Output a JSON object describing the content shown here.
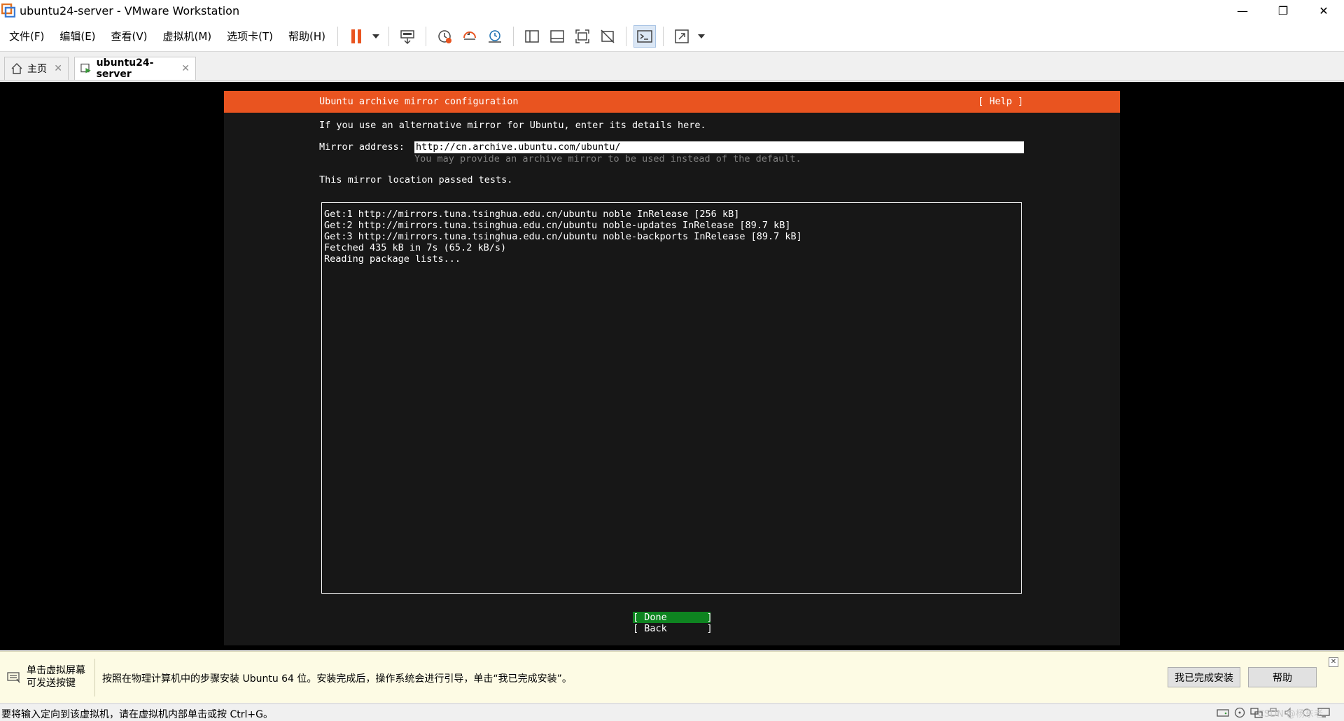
{
  "window": {
    "title": "ubuntu24-server - VMware Workstation",
    "controls": {
      "minimize": "—",
      "restore": "❐",
      "close": "✕"
    }
  },
  "menu": {
    "items": [
      "文件(F)",
      "编辑(E)",
      "查看(V)",
      "虚拟机(M)",
      "选项卡(T)",
      "帮助(H)"
    ]
  },
  "toolbar": {
    "icons": [
      "pause-icon",
      "dropdown-icon",
      "send-ctrl-alt-del-icon",
      "snapshot-icon",
      "revert-snapshot-icon",
      "snapshot-manager-icon",
      "library-icon",
      "thumbnail-icon",
      "fullscreen-icon",
      "unity-icon",
      "console-view-icon",
      "stretch-icon"
    ],
    "accent": "#e95420"
  },
  "tabs": [
    {
      "label": "主页",
      "icon": "home-icon",
      "active": false
    },
    {
      "label": "ubuntu24-server",
      "icon": "vm-icon",
      "active": true
    }
  ],
  "console": {
    "header_title": "Ubuntu archive mirror configuration",
    "help_label": "[ Help ]",
    "intro": "If you use an alternative mirror for Ubuntu, enter its details here.",
    "mirror_label": "Mirror address:",
    "mirror_value": "http://cn.archive.ubuntu.com/ubuntu/",
    "mirror_hint": "You may provide an archive mirror to be used instead of the default.",
    "status": "This mirror location passed tests.",
    "log_lines": [
      "Get:1 http://mirrors.tuna.tsinghua.edu.cn/ubuntu noble InRelease [256 kB]",
      "Get:2 http://mirrors.tuna.tsinghua.edu.cn/ubuntu noble-updates InRelease [89.7 kB]",
      "Get:3 http://mirrors.tuna.tsinghua.edu.cn/ubuntu noble-backports InRelease [89.7 kB]",
      "Fetched 435 kB in 7s (65.2 kB/s)",
      "Reading package lists..."
    ],
    "done_label": "[ Done       ]",
    "back_label": "[ Back       ]",
    "header_color": "#e95420",
    "done_color": "#0e8420"
  },
  "hintbar": {
    "left_line1": "单击虚拟屏幕",
    "left_line2": "可发送按键",
    "message": "按照在物理计算机中的步骤安装 Ubuntu 64 位。安装完成后，操作系统会进行引导，单击“我已完成安装”。",
    "done_install_label": "我已完成安装",
    "help_label": "帮助",
    "close_label": "✕"
  },
  "statusbar": {
    "text": "要将输入定向到该虚拟机，请在虚拟机内部单击或按 Ctrl+G。",
    "watermark": "CSDN @杨东老",
    "icons": [
      "hdd-icon",
      "cd-icon",
      "network-icon",
      "printer-icon",
      "sound-icon",
      "usb-icon",
      "display-icon"
    ]
  }
}
